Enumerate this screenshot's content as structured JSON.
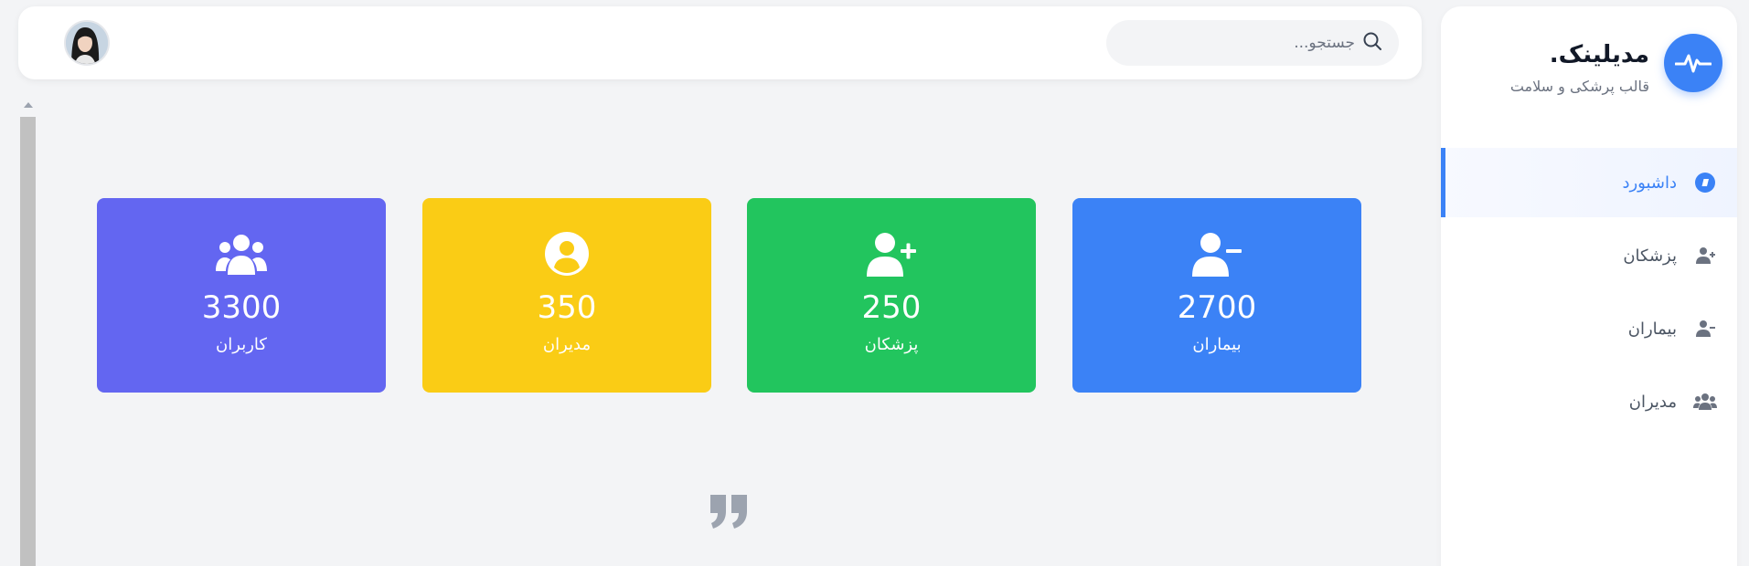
{
  "brand": {
    "name": "مدیلینک.",
    "tagline": "قالب پرشکی و سلامت"
  },
  "sidebar": {
    "items": [
      {
        "label": "داشبورد",
        "icon": "dashboard-icon",
        "active": true
      },
      {
        "label": "پزشکان",
        "icon": "user-plus-icon",
        "active": false
      },
      {
        "label": "بیماران",
        "icon": "user-minus-icon",
        "active": false
      },
      {
        "label": "مدیران",
        "icon": "users-icon",
        "active": false
      }
    ]
  },
  "header": {
    "search_placeholder": "جستجو..."
  },
  "stats": [
    {
      "value": "2700",
      "label": "بیماران",
      "icon": "user-minus-icon",
      "color": "#3b82f6"
    },
    {
      "value": "250",
      "label": "پزشکان",
      "icon": "user-plus-icon",
      "color": "#22c55e"
    },
    {
      "value": "350",
      "label": "مدیران",
      "icon": "user-circle-icon",
      "color": "#facc15"
    },
    {
      "value": "3300",
      "label": "کاربران",
      "icon": "users-icon",
      "color": "#6366f1"
    }
  ],
  "colors": {
    "accent": "#3b82f6",
    "background": "#f3f4f6"
  }
}
